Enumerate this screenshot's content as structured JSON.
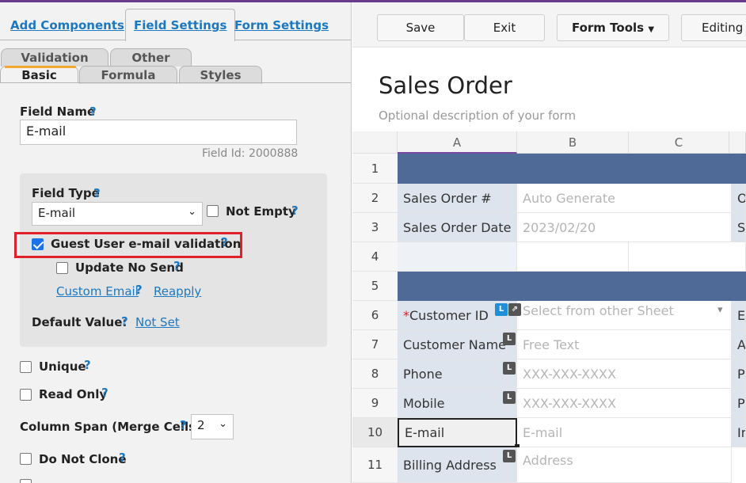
{
  "top_tabs": [
    "Add Components",
    "Field Settings",
    "Form Settings"
  ],
  "sub_tabs_row1": [
    "Validation",
    "Other"
  ],
  "sub_tabs_row2": [
    "Basic",
    "Formula",
    "Styles"
  ],
  "field": {
    "name_label": "Field Name",
    "name_value": "E-mail",
    "field_id": "Field Id: 2000888",
    "type_label": "Field Type",
    "type_value": "E-mail",
    "not_empty_label": "Not Empty",
    "guest_validation_label": "Guest User e-mail validation",
    "update_no_send_label": "Update No Send",
    "custom_email_link": "Custom Email",
    "reapply_link": "Reapply",
    "default_value_label": "Default Value:",
    "default_value_link": "Not Set",
    "unique_label": "Unique",
    "read_only_label": "Read Only",
    "column_span_label": "Column Span (Merge Cells)",
    "column_span_value": "2",
    "do_not_clone_label": "Do Not Clone",
    "help_glyph": "?"
  },
  "checkbox_states": {
    "not_empty": false,
    "guest_validation": true,
    "update_no_send": false,
    "unique": false,
    "read_only": false,
    "do_not_clone": false
  },
  "toolbar": {
    "save": "Save",
    "exit": "Exit",
    "form_tools": "Form Tools",
    "editing": "Editing"
  },
  "form": {
    "title": "Sales Order",
    "description": "Optional description of your form",
    "columns": [
      "A",
      "B",
      "C"
    ],
    "rows": [
      {
        "num": "1"
      },
      {
        "num": "2",
        "label": "Sales Order #",
        "value": "Auto Generate",
        "extra": "O"
      },
      {
        "num": "3",
        "label": "Sales Order Date",
        "value": "2023/02/20",
        "extra": "St"
      },
      {
        "num": "4"
      },
      {
        "num": "5"
      },
      {
        "num": "6",
        "required": "*",
        "label": "Customer ID",
        "value": "Select from other Sheet",
        "extra": "El"
      },
      {
        "num": "7",
        "label": "Customer Name",
        "value": "Free Text",
        "extra": "A"
      },
      {
        "num": "8",
        "label": "Phone",
        "value": "XXX-XXX-XXXX",
        "extra": "P"
      },
      {
        "num": "9",
        "label": "Mobile",
        "value": "XXX-XXX-XXXX",
        "extra": "P"
      },
      {
        "num": "10",
        "label": "E-mail",
        "value": "E-mail",
        "extra": "In"
      },
      {
        "num": "11",
        "label": "Billing Address",
        "value": "Address"
      }
    ],
    "badge_l": "L",
    "badge_link": "⇗",
    "dropdown_arrow": "▾"
  },
  "colors": {
    "accent_blue": "#1c78c0",
    "band_blue": "#4f6a96",
    "label_cell": "#dde4ee",
    "highlight_red": "#e0202a"
  }
}
